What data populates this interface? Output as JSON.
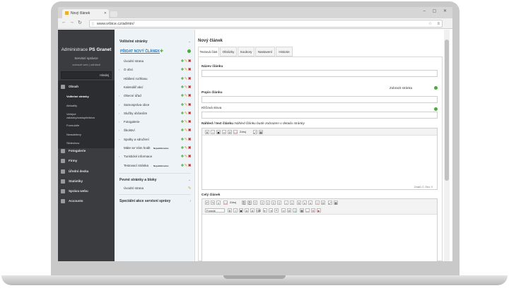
{
  "browser": {
    "tab_title": "Nový článek",
    "url": "www.vrbice.cz/admin/"
  },
  "sidebar": {
    "title_prefix": "Administrace",
    "title_brand": "PS Granet",
    "subtitle": "Servisní správce",
    "links": "zobrazit web | odhlásit",
    "search_button": "Hledej",
    "menu": [
      {
        "label": "Obsah",
        "icon": "document-icon"
      },
      {
        "label": "Fotogalerie",
        "icon": "camera-icon"
      },
      {
        "label": "Firmy",
        "icon": "building-icon"
      },
      {
        "label": "Úřední deska",
        "icon": "board-icon"
      },
      {
        "label": "Statistiky",
        "icon": "chart-icon"
      },
      {
        "label": "Správa webu",
        "icon": "gear-icon"
      },
      {
        "label": "Accounts",
        "icon": "user-icon"
      }
    ],
    "submenu": [
      {
        "label": "Volitelné stránky",
        "active": true
      },
      {
        "label": "Aktuality",
        "active": false
      },
      {
        "label": "Veřejné zakázky/zastupitelstva",
        "active": false
      },
      {
        "label": "Formuláře",
        "active": false
      },
      {
        "label": "Newslettery",
        "active": false
      },
      {
        "label": "Slideshow",
        "active": false
      }
    ]
  },
  "pages_panel": {
    "heading": "Volitelné stránky",
    "add_link": "PŘIDAT NOVÝ ČLÁNEK",
    "pages": [
      {
        "label": "Úvodní strana",
        "has_children": false,
        "tag": ""
      },
      {
        "label": "O obci",
        "has_children": true,
        "tag": ""
      },
      {
        "label": "Hlášení rozhlasu",
        "has_children": false,
        "tag": ""
      },
      {
        "label": "Kalendář akcí",
        "has_children": false,
        "tag": ""
      },
      {
        "label": "Obecní úřad",
        "has_children": true,
        "tag": ""
      },
      {
        "label": "Samospráva obce",
        "has_children": true,
        "tag": ""
      },
      {
        "label": "Služby občanům",
        "has_children": true,
        "tag": ""
      },
      {
        "label": "Fotogalerie",
        "has_children": true,
        "tag": ""
      },
      {
        "label": "Školství",
        "has_children": true,
        "tag": ""
      },
      {
        "label": "Spolky a sdružení",
        "has_children": true,
        "tag": ""
      },
      {
        "label": "Máte se Vám hodit",
        "has_children": false,
        "tag": "Nepublikováno"
      },
      {
        "label": "Turistické informace",
        "has_children": true,
        "tag": ""
      },
      {
        "label": "Testovací stránka",
        "has_children": false,
        "tag": "Nepublikováno"
      }
    ],
    "fixed_heading": "Pevné stránky a bloky",
    "fixed_item": "Úvodní strana",
    "special_heading": "Speciální akce servisní správy"
  },
  "article": {
    "heading": "Nový článek",
    "tabs": [
      "Textová část",
      "Obrázky",
      "Soubory",
      "Nastavení",
      "Historie"
    ],
    "title_label": "Název článku",
    "show_page_label": "Zobrazit stránku",
    "desc_label": "Popis článku",
    "keywords_label": "Klíčová slova",
    "preview_label": "Náhled / text článku",
    "preview_hint": "Náhled článku bude zobrazen v detailu stránky",
    "editor1_footer": "Znaků: 0, Slov: 0",
    "full_label": "Celý článek",
    "format_select": "Formát",
    "colors": {
      "accent_green": "#4caa3c",
      "link_blue": "#2d7bb8",
      "delete_red": "#d0212b"
    }
  }
}
